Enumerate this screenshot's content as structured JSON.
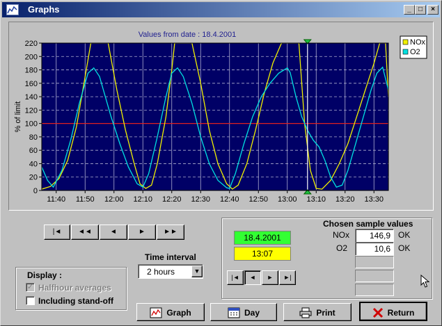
{
  "window": {
    "title": "Graphs",
    "min_label": "_",
    "max_label": "□",
    "close_label": "×"
  },
  "chart": {
    "header": "Values from date : 18.4.2001",
    "ylabel": "% of limit"
  },
  "chart_data": {
    "type": "line",
    "title": "Values from date : 18.4.2001",
    "ylabel": "% of limit",
    "xlabel": "",
    "ylim": [
      0,
      220
    ],
    "yticks": [
      0,
      20,
      40,
      60,
      80,
      100,
      120,
      140,
      160,
      180,
      200,
      220
    ],
    "xlim": [
      "11:35",
      "13:35"
    ],
    "xticks": [
      "11:40",
      "11:50",
      "12:00",
      "12:10",
      "12:20",
      "12:30",
      "12:40",
      "12:50",
      "13:00",
      "13:10",
      "13:20",
      "13:30"
    ],
    "grid": true,
    "reference_line": {
      "y": 100,
      "color": "#e02020"
    },
    "cursor": {
      "x": "13:07"
    },
    "legend_position": "top-right",
    "series": [
      {
        "name": "NOx",
        "color": "#f0f000",
        "x": [
          "11:35",
          "11:38",
          "11:41",
          "11:44",
          "11:47",
          "11:50",
          "11:52",
          "11:55",
          "11:58",
          "12:01",
          "12:04",
          "12:07",
          "12:09",
          "12:11",
          "12:13",
          "12:15",
          "12:18",
          "12:20",
          "12:21",
          "12:24",
          "12:27",
          "12:30",
          "12:33",
          "12:36",
          "12:39",
          "12:41",
          "12:43",
          "12:46",
          "12:49",
          "12:52",
          "12:55",
          "12:58",
          "13:01",
          "13:03",
          "13:04",
          "13:06",
          "13:08",
          "13:10",
          "13:12",
          "13:15",
          "13:18",
          "13:21",
          "13:24",
          "13:27",
          "13:30",
          "13:32",
          "13:34",
          "13:35"
        ],
        "values": [
          2,
          6,
          18,
          45,
          95,
          170,
          225,
          225,
          225,
          150,
          90,
          40,
          10,
          3,
          8,
          40,
          110,
          180,
          225,
          225,
          225,
          160,
          90,
          40,
          10,
          2,
          8,
          40,
          90,
          145,
          190,
          225,
          225,
          225,
          225,
          100,
          30,
          3,
          2,
          15,
          40,
          70,
          110,
          150,
          190,
          225,
          225,
          140
        ]
      },
      {
        "name": "O2",
        "color": "#00e0e0",
        "x": [
          "11:35",
          "11:37",
          "11:39",
          "11:42",
          "11:45",
          "11:48",
          "11:51",
          "11:53",
          "11:55",
          "11:57",
          "11:59",
          "12:02",
          "12:05",
          "12:08",
          "12:10",
          "12:12",
          "12:15",
          "12:18",
          "12:20",
          "12:22",
          "12:24",
          "12:27",
          "12:30",
          "12:33",
          "12:36",
          "12:39",
          "12:40",
          "12:42",
          "12:45",
          "12:48",
          "12:51",
          "12:54",
          "12:57",
          "13:00",
          "13:01",
          "13:03",
          "13:05",
          "13:07",
          "13:09",
          "13:11",
          "13:13",
          "13:15",
          "13:17",
          "13:19",
          "13:21",
          "13:23",
          "13:25",
          "13:27",
          "13:29",
          "13:31",
          "13:33",
          "13:35"
        ],
        "values": [
          35,
          15,
          5,
          30,
          75,
          130,
          175,
          183,
          170,
          140,
          110,
          70,
          35,
          10,
          5,
          25,
          80,
          140,
          175,
          183,
          170,
          130,
          80,
          40,
          15,
          4,
          3,
          25,
          70,
          110,
          140,
          160,
          175,
          183,
          176,
          140,
          110,
          90,
          75,
          65,
          45,
          20,
          5,
          8,
          30,
          60,
          90,
          120,
          150,
          175,
          184,
          150
        ]
      }
    ]
  },
  "nav": {
    "first": "|◄",
    "rewind": "◄◄",
    "back": "◄",
    "forward": "►",
    "fastforward": "►►"
  },
  "sample": {
    "date": "18.4.2001",
    "time": "13:07",
    "title": "Chosen sample values",
    "rows": [
      {
        "name": "NOx",
        "value": "146,9",
        "status": "OK"
      },
      {
        "name": "O2",
        "value": "10,6",
        "status": "OK"
      }
    ],
    "nav": {
      "first": "|◄",
      "back": "◄",
      "forward": "►",
      "last": "►|"
    }
  },
  "time_interval": {
    "label": "Time interval",
    "value": "2 hours"
  },
  "display": {
    "title": "Display :",
    "halfhour_label": "Halfhour averages",
    "halfhour_checked": true,
    "halfhour_disabled": true,
    "standoff_label": "Including stand-off",
    "standoff_checked": false
  },
  "buttons": {
    "graph": "Graph",
    "day": "Day",
    "print": "Print",
    "return": "Return"
  },
  "colors": {
    "plot_bg": "#000066",
    "nox": "#f0f000",
    "o2": "#00e0e0",
    "date_bg": "#33ff33",
    "time_bg": "#ffff00",
    "return_icon": "#d00000"
  }
}
